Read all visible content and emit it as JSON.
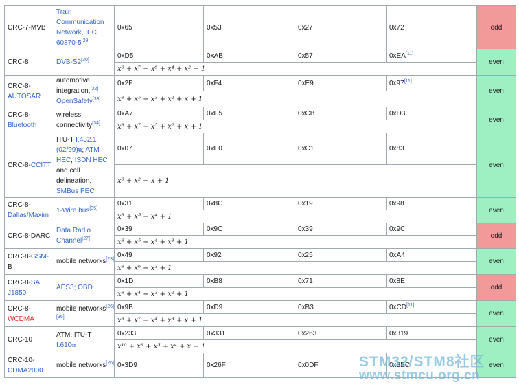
{
  "rows": [
    {
      "name": "CRC-7-MVB",
      "name_pre": "",
      "name_link": "",
      "use": "Train Communication Network, IEC 60870-5",
      "use_ref": "[29]",
      "vals": [
        "0x65",
        "0x53",
        "0x27",
        "0x72"
      ],
      "val4_ref": "",
      "poly": "",
      "parity": "odd"
    },
    {
      "name": "CRC-8",
      "name_pre": "",
      "name_link": "",
      "use": "DVB-S2",
      "use_ref": "[30]",
      "vals": [
        "0xD5",
        "0xAB",
        "0x57",
        "0xEA"
      ],
      "val4_ref": "[11]",
      "poly": "x⁸ + x⁷ + x⁶ + x⁴ + x² + 1",
      "parity": "even"
    },
    {
      "name": "",
      "name_pre": "CRC-8-",
      "name_link": "AUTOSAR",
      "use": "automotive integration,",
      "use_ref": "[32]",
      "use2": "OpenSafety",
      "use2_ref": "[33]",
      "vals": [
        "0x2F",
        "0xF4",
        "0xE9",
        "0x97"
      ],
      "val4_ref": "[11]",
      "poly": "x⁸ + x⁵ + x³ + x² + x + 1",
      "parity": "even"
    },
    {
      "name": "",
      "name_pre": "CRC-8-",
      "name_link": "Bluetooth",
      "use": "wireless connectivity",
      "use_ref": "[34]",
      "vals": [
        "0xA7",
        "0xE5",
        "0xCB",
        "0xD3"
      ],
      "val4_ref": "",
      "poly": "x⁸ + x⁷ + x⁵ + x² + x + 1",
      "parity": "even"
    },
    {
      "name": "",
      "name_pre": "CRC-8-",
      "name_link": "CCITT",
      "use_pre": "ITU-T",
      "use_link1": "I.432.1 (02/99)",
      "use_mid": ";",
      "use_link2": "ATM HEC",
      "use_mid2": ",",
      "use_link3": "ISDN HEC",
      "use_post": "and cell delineation,",
      "use_link4": "SMBus PEC",
      "vals": [
        "0x07",
        "0xE0",
        "0xC1",
        "0x83"
      ],
      "val4_ref": "",
      "poly": "x⁸ + x² + x + 1",
      "parity": "even"
    },
    {
      "name": "",
      "name_pre": "CRC-8-",
      "name_link": "Dallas/Maxim",
      "use": "1-Wire bus",
      "use_ref": "[35]",
      "vals": [
        "0x31",
        "0x8C",
        "0x19",
        "0x98"
      ],
      "val4_ref": "",
      "poly": "x⁸ + x⁵ + x⁴ + 1",
      "parity": "even"
    },
    {
      "name": "CRC-8-DARC",
      "name_pre": "",
      "name_link": "",
      "use": "Data Radio Channel",
      "use_ref": "[27]",
      "vals": [
        "0x39",
        "0x9C",
        "0x39",
        "0x9C"
      ],
      "val4_ref": "",
      "poly": "x⁸ + x⁵ + x⁴ + x³ + 1",
      "parity": "odd"
    },
    {
      "name": "",
      "name_pre": "CRC-8-",
      "name_link": "GSM-",
      "name_post": "B",
      "use": "mobile networks",
      "use_ref": "[23]",
      "vals": [
        "0x49",
        "0x92",
        "0x25",
        "0xA4"
      ],
      "val4_ref": "",
      "poly": "x⁸ + x⁶ + x³ + 1",
      "parity": "even"
    },
    {
      "name": "",
      "name_pre": "CRC-8-",
      "name_link": "SAE J1850",
      "use": "AES3; OBD",
      "use_ref": "",
      "vals": [
        "0x1D",
        "0xB8",
        "0x71",
        "0x8E"
      ],
      "val4_ref": "",
      "poly": "x⁸ + x⁴ + x³ + x² + 1",
      "parity": "odd"
    },
    {
      "name": "",
      "name_pre": "CRC-8-",
      "name_link": "WCDMA",
      "use": "mobile networks",
      "use_ref": "[26][36]",
      "vals": [
        "0x9B",
        "0xD9",
        "0xB3",
        "0xCD"
      ],
      "val4_ref": "[11]",
      "poly": "x⁸ + x⁷ + x⁴ + x³ + x + 1",
      "parity": "even"
    },
    {
      "name": "CRC-10",
      "name_pre": "",
      "name_link": "",
      "use_pre": "ATM; ITU-T",
      "use_link1": "I.610",
      "vals": [
        "0x233",
        "0x331",
        "0x263",
        "0x319"
      ],
      "val4_ref": "",
      "poly": "x¹⁰ + x⁹ + x⁵ + x⁴ + x + 1",
      "parity": "even"
    },
    {
      "name": "",
      "name_pre": "CRC-10-",
      "name_link": "CDMA2000",
      "use": "mobile networks",
      "use_ref": "[26]",
      "vals": [
        "0x3D9",
        "0x26F",
        "0x0DF",
        "0x3EC"
      ],
      "val4_ref": "",
      "poly": "",
      "parity": "even"
    }
  ],
  "watermark": {
    "line1": "STM32/STM8社区",
    "line2": "www.stmcu.org.cn"
  },
  "colors": {
    "even": "#9ef0c2",
    "odd": "#f29a9a",
    "link": "#3366cc",
    "redlink": "#dd3333"
  }
}
